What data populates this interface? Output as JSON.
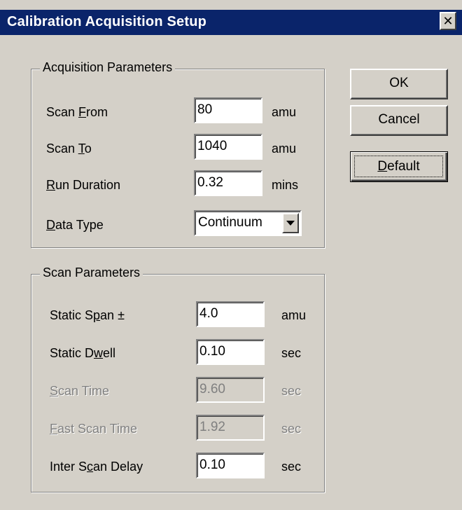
{
  "window": {
    "title": "Calibration Acquisition Setup",
    "close_glyph": "✕"
  },
  "acquisition": {
    "group_title": "Acquisition Parameters",
    "scan_from": {
      "label_pre": "Scan ",
      "label_key": "F",
      "label_post": "rom",
      "value": "80",
      "unit": "amu"
    },
    "scan_to": {
      "label_pre": "Scan ",
      "label_key": "T",
      "label_post": "o",
      "value": "1040",
      "unit": "amu"
    },
    "run_duration": {
      "label_pre": "",
      "label_key": "R",
      "label_post": "un Duration",
      "value": "0.32",
      "unit": "mins"
    },
    "data_type": {
      "label_pre": "",
      "label_key": "D",
      "label_post": "ata Type",
      "value": "Continuum"
    }
  },
  "scan": {
    "group_title": "Scan Parameters",
    "static_span": {
      "label_pre": "Static S",
      "label_key": "p",
      "label_post": "an ±",
      "value": "4.0",
      "unit": "amu"
    },
    "static_dwell": {
      "label_pre": "Static D",
      "label_key": "w",
      "label_post": "ell",
      "value": "0.10",
      "unit": "sec"
    },
    "scan_time": {
      "label_pre": "",
      "label_key": "S",
      "label_post": "can Time",
      "value": "9.60",
      "unit": "sec"
    },
    "fast_scan_time": {
      "label_pre": "",
      "label_key": "F",
      "label_post": "ast Scan Time",
      "value": "1.92",
      "unit": "sec"
    },
    "inter_scan_delay": {
      "label_pre": "Inter S",
      "label_key": "c",
      "label_post": "an Delay",
      "value": "0.10",
      "unit": "sec"
    }
  },
  "buttons": {
    "ok": "OK",
    "cancel": "Cancel",
    "default_pre": "",
    "default_key": "D",
    "default_post": "efault"
  },
  "colors": {
    "title_bar": "#0a246a",
    "face": "#d4d0c8",
    "disabled_text": "#808080"
  }
}
